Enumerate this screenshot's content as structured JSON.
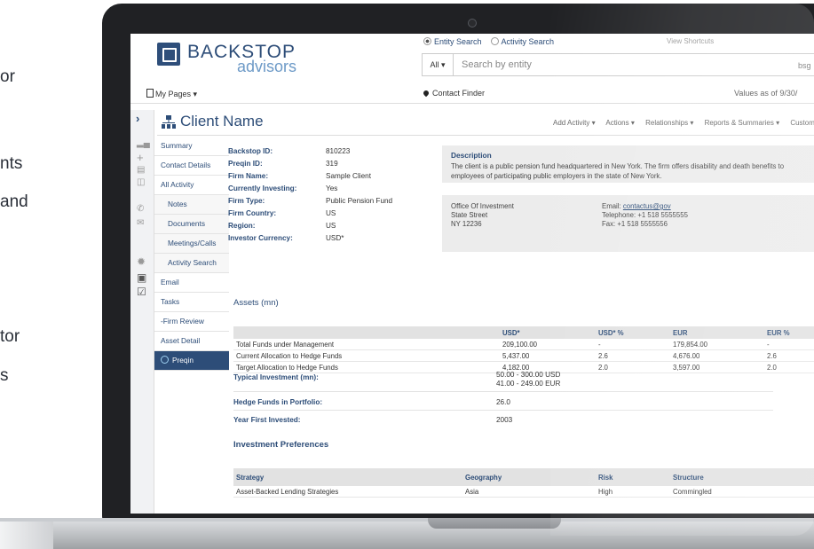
{
  "marketing_text": [
    "or",
    "nts",
    "and",
    "tor",
    "s"
  ],
  "app": {
    "logo_line1": "BACKSTOP",
    "logo_line2": "advisors",
    "search_modes": [
      "Entity Search",
      "Activity Search"
    ],
    "view_shortcuts": "View Shortcuts",
    "search_scope": "All ▾",
    "search_placeholder": "Search by entity",
    "user_fragment": "bsg",
    "my_pages": "My Pages ▾",
    "contact_finder": "Contact Finder",
    "values_as_of": "Values as of 9/30/"
  },
  "client": {
    "name": "Client Name",
    "menus": [
      "Add Activity ▾",
      "Actions ▾",
      "Relationships ▾",
      "Reports & Summaries ▾",
      "Custom L"
    ]
  },
  "nav": {
    "items": [
      {
        "label": "Summary",
        "sub": false
      },
      {
        "label": "Contact Details",
        "sub": false
      },
      {
        "label": "All Activity",
        "sub": false
      },
      {
        "label": "Notes",
        "sub": true
      },
      {
        "label": "Documents",
        "sub": true
      },
      {
        "label": "Meetings/Calls",
        "sub": true
      },
      {
        "label": "Activity Search",
        "sub": true
      },
      {
        "label": "Email",
        "sub": false
      },
      {
        "label": "Tasks",
        "sub": false
      },
      {
        "label": "-Firm Review",
        "sub": false
      },
      {
        "label": "Asset Detail",
        "sub": false
      },
      {
        "label": "Preqin",
        "sub": false
      }
    ]
  },
  "fields": [
    {
      "label": "Backstop ID:",
      "value": "810223"
    },
    {
      "label": "Preqin ID:",
      "value": "319"
    },
    {
      "label": "Firm Name:",
      "value": "Sample Client"
    },
    {
      "label": "Currently Investing:",
      "value": "Yes"
    },
    {
      "label": "Firm Type:",
      "value": "Public Pension Fund"
    },
    {
      "label": "Firm Country:",
      "value": "US"
    },
    {
      "label": "Region:",
      "value": "US"
    },
    {
      "label": "Investor Currency:",
      "value": "USD*"
    }
  ],
  "description": {
    "title": "Description",
    "text": "The client is a public pension fund headquartered in New York. The firm offers disability and death benefits to employees of participating public employers in the state of New York."
  },
  "office": {
    "name": "Office Of Investment",
    "street": "State Street",
    "city": "NY 12236",
    "email_label": "Email:",
    "email": "contactus@gov",
    "telephone": "Telephone: +1 518 5555555",
    "fax": "Fax: +1 518 5555556"
  },
  "assets": {
    "title": "Assets (mn)",
    "columns": [
      "",
      "USD*",
      "USD* %",
      "EUR",
      "EUR %"
    ],
    "rows": [
      [
        "Total Funds under Management",
        "209,100.00",
        "-",
        "179,854.00",
        "-"
      ],
      [
        "Current Allocation to Hedge Funds",
        "5,437.00",
        "2.6",
        "4,676.00",
        "2.6"
      ],
      [
        "Target Allocation to Hedge Funds",
        "4,182.00",
        "2.0",
        "3,597.00",
        "2.0"
      ]
    ]
  },
  "investment": {
    "typical_label": "Typical Investment (mn):",
    "typical_usd": "50.00 - 300.00 USD",
    "typical_eur": "41.00 - 249.00 EUR",
    "hedge_label": "Hedge Funds in Portfolio:",
    "hedge_value": "26.0",
    "year_label": "Year First Invested:",
    "year_value": "2003"
  },
  "preferences": {
    "title": "Investment Preferences",
    "columns": [
      "Strategy",
      "Geography",
      "Risk",
      "Structure"
    ],
    "rows": [
      [
        "Asset-Backed Lending Strategies",
        "Asia",
        "High",
        "Commingled"
      ]
    ]
  }
}
